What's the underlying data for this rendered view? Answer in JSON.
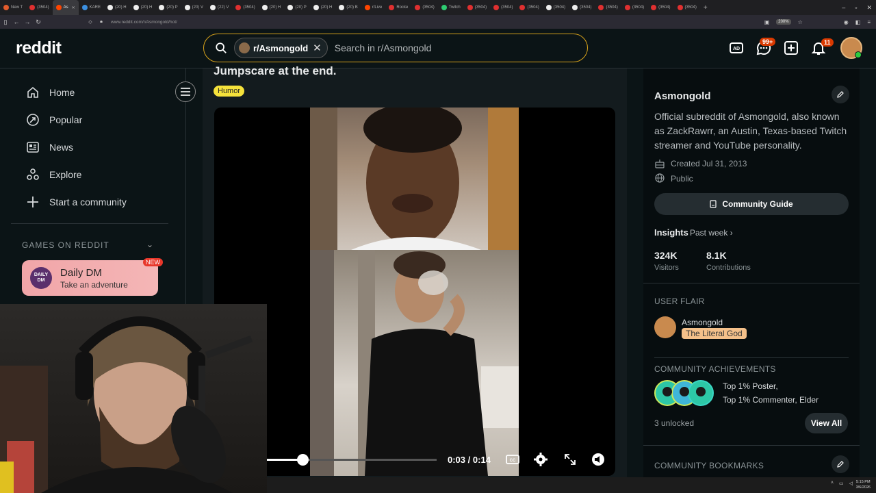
{
  "browser": {
    "tabs": [
      {
        "label": "New T",
        "color": "#e35b2c"
      },
      {
        "label": "(3504)",
        "color": "#e03030"
      },
      {
        "label": "As",
        "color": "#ff4500",
        "active": true
      },
      {
        "label": "KARE",
        "color": "#3b8fe0"
      },
      {
        "label": "(20) H",
        "color": "#eeeeee"
      },
      {
        "label": "(20) H",
        "color": "#eeeeee"
      },
      {
        "label": "(20) P",
        "color": "#eeeeee"
      },
      {
        "label": "(20) V",
        "color": "#eeeeee"
      },
      {
        "label": "(22) V",
        "color": "#eeeeee"
      },
      {
        "label": "(3504)",
        "color": "#e03030"
      },
      {
        "label": "(20) H",
        "color": "#eeeeee"
      },
      {
        "label": "(20) P",
        "color": "#eeeeee"
      },
      {
        "label": "(20) H",
        "color": "#eeeeee"
      },
      {
        "label": "(20) B",
        "color": "#eeeeee"
      },
      {
        "label": "r/Live",
        "color": "#ff4500"
      },
      {
        "label": "Rocke",
        "color": "#e03030"
      },
      {
        "label": "(3504)",
        "color": "#e03030"
      },
      {
        "label": "Twitch",
        "color": "#2ecc71"
      },
      {
        "label": "(3504)",
        "color": "#e03030"
      },
      {
        "label": "(3504)",
        "color": "#e03030"
      },
      {
        "label": "(3504)",
        "color": "#e03030"
      },
      {
        "label": "(3504)",
        "color": "#eeeeee"
      },
      {
        "label": "(3504)",
        "color": "#eeeeee"
      },
      {
        "label": "(3504)",
        "color": "#e03030"
      },
      {
        "label": "(3504)",
        "color": "#e03030"
      },
      {
        "label": "(3504)",
        "color": "#e03030"
      },
      {
        "label": "(3504)",
        "color": "#e03030"
      }
    ],
    "url": "www.reddit.com/r/Asmongold/hot/",
    "zoom": "200%"
  },
  "header": {
    "logo": "reddit",
    "search_chip": "r/Asmongold",
    "search_placeholder": "Search in r/Asmongold",
    "chat_badge": "99+",
    "notif_badge": "11"
  },
  "sidebar": {
    "items": [
      {
        "label": "Home",
        "icon": "home-icon"
      },
      {
        "label": "Popular",
        "icon": "popular-icon"
      },
      {
        "label": "News",
        "icon": "news-icon"
      },
      {
        "label": "Explore",
        "icon": "explore-icon"
      },
      {
        "label": "Start a community",
        "icon": "plus-icon"
      }
    ],
    "games_title": "GAMES ON REDDIT",
    "game": {
      "logo_text": "DAILY DM",
      "title": "Daily DM",
      "subtitle": "Take an adventure",
      "badge": "NEW"
    }
  },
  "post": {
    "title": "Jumpscare at the end.",
    "flair": "Humor",
    "video": {
      "current": "0:03",
      "separator": "/",
      "duration": "0:14",
      "progress": 0.214
    }
  },
  "community": {
    "name": "Asmongold",
    "description": "Official subreddit of Asmongold, also known as ZackRawrr, an Austin, Texas-based Twitch streamer and YouTube personality.",
    "created": "Created Jul 31, 2013",
    "visibility": "Public",
    "guide_button": "Community Guide",
    "insights_label": "Insights",
    "insights_period": "Past week",
    "visitors_value": "324K",
    "visitors_label": "Visitors",
    "contributions_value": "8.1K",
    "contributions_label": "Contributions",
    "user_flair_title": "USER FLAIR",
    "flair_user": "Asmongold",
    "flair_tag": "The Literal God",
    "achievements_title": "COMMUNITY ACHIEVEMENTS",
    "achievements_line1": "Top 1% Poster,",
    "achievements_line2": "Top 1% Commenter, Elder",
    "unlocked": "3 unlocked",
    "view_all": "View All",
    "bookmarks_title": "COMMUNITY BOOKMARKS"
  },
  "taskbar": {
    "time": "5:15 PM",
    "date": "3/6/2026"
  }
}
